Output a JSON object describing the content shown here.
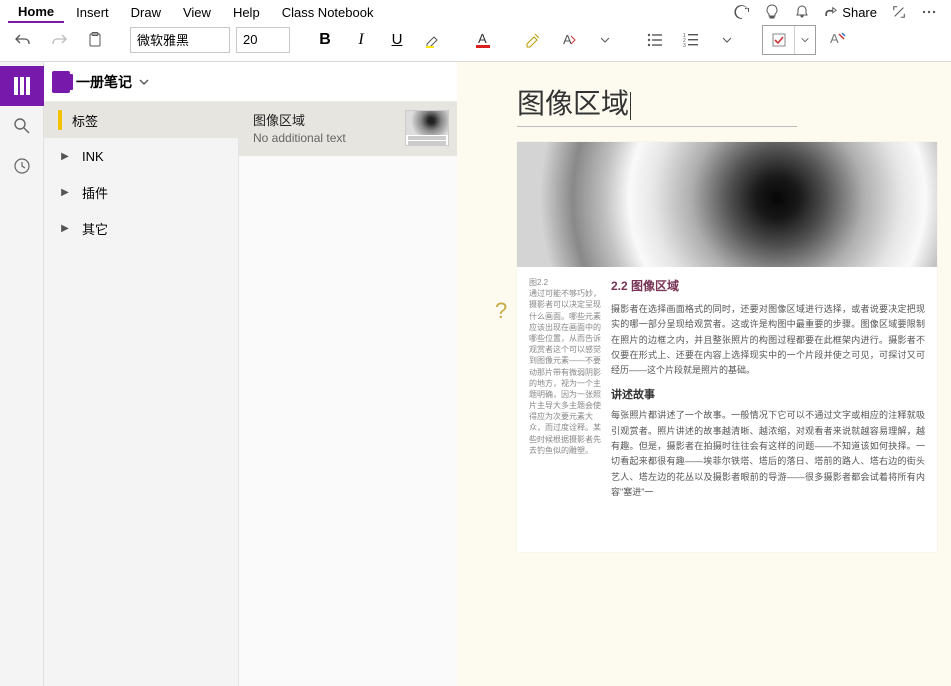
{
  "menu": {
    "items": [
      "Home",
      "Insert",
      "Draw",
      "View",
      "Help",
      "Class Notebook"
    ],
    "active": 0,
    "share_label": "Share"
  },
  "toolbar": {
    "font_name": "微软雅黑",
    "font_size": "20"
  },
  "notebook": {
    "name": "一册笔记"
  },
  "sections": [
    {
      "label": "标签",
      "expandable": false,
      "active": true
    },
    {
      "label": "INK",
      "expandable": true,
      "active": false
    },
    {
      "label": "插件",
      "expandable": true,
      "active": false
    },
    {
      "label": "其它",
      "expandable": true,
      "active": false
    }
  ],
  "pages": [
    {
      "title": "图像区域",
      "subtitle": "No additional text",
      "active": true
    }
  ],
  "page": {
    "title": "图像区域",
    "help_icon": "?",
    "scan": {
      "heading": "2.2 图像区域",
      "p1": "摄影者在选择画面格式的同时，还要对图像区域进行选择，或者说要决定把现实的哪一部分呈现给观赏者。这或许是构图中最重要的步骤。图像区域要限制在照片的边框之内，并且整张照片的构图过程都要在此框架内进行。摄影者不仅要在形式上、还要在内容上选择现实中的一个片段并使之可见，可探讨又可经历——这个片段就是照片的基础。",
      "sub": "讲述故事",
      "p2": "每张照片都讲述了一个故事。一般情况下它可以不通过文字或相应的注释就吸引观赏者。照片讲述的故事越清晰、越浓缩，对观看者来说就越容易理解，越有趣。但是，摄影者在拍摄时往往会有这样的问题——不知道该如何抉择。一切看起来都很有趣——埃菲尔铁塔、塔后的落日、塔前的路人、塔右边的街头艺人、塔左边的花丛以及摄影者眼前的导游——很多摄影者都会试着将所有内容\"塞进\"一",
      "side": "图2.2\n通过可能不够巧妙，摄影者可以决定呈现什么画面。哪些元素应该出现在画面中的哪些位置，从而告诉观赏者这个可以感觉到图像元素——不要动那片带有微弱阴影的地方，视为一个主题明确，因为一张照片主导大多主题会使得应为次要元素大众，而过度诠释。某些时候根据摄影者先去钓鱼似的雕塑。"
    }
  }
}
